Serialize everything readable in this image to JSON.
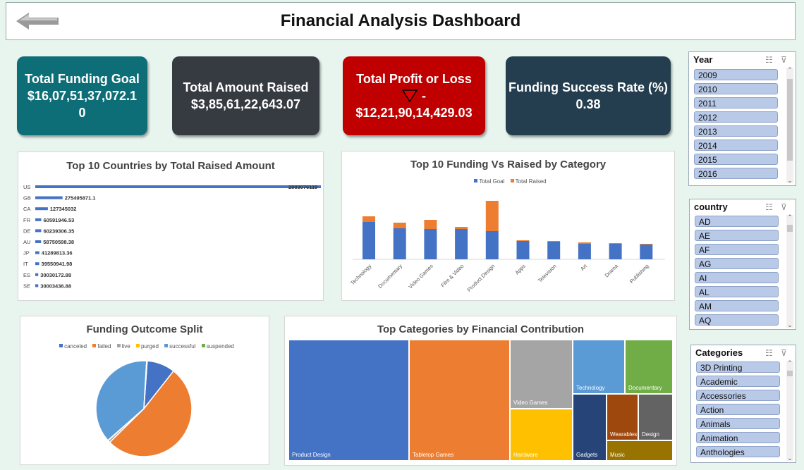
{
  "header": {
    "title": "Financial Analysis Dashboard"
  },
  "kpis": {
    "funding_goal": {
      "label": "Total Funding Goal",
      "value_line1": "$16,07,51,37,072.1",
      "value_line2": "0",
      "color": "#0e6e77"
    },
    "amount_raised": {
      "label": "Total Amount Raised",
      "value": "$3,85,61,22,643.07",
      "color": "#363a41"
    },
    "profit_loss": {
      "label": "Total Profit or Loss",
      "sign": "-",
      "value": "$12,21,90,14,429.03",
      "color": "#c00000"
    },
    "success_rate": {
      "label": "Funding Success Rate (%)",
      "value": "0.38",
      "color": "#243e4f"
    }
  },
  "slicers": {
    "year": {
      "header": "Year",
      "items": [
        "2009",
        "2010",
        "2011",
        "2012",
        "2013",
        "2014",
        "2015",
        "2016"
      ]
    },
    "country": {
      "header": "country",
      "items": [
        "AD",
        "AE",
        "AF",
        "AG",
        "AI",
        "AL",
        "AM",
        "AQ"
      ]
    },
    "categories": {
      "header": "Categories",
      "items": [
        "3D Printing",
        "Academic",
        "Accessories",
        "Action",
        "Animals",
        "Animation",
        "Anthologies"
      ]
    }
  },
  "chart_data": [
    {
      "type": "bar",
      "orientation": "horizontal",
      "title": "Top 10 Countries by Total Raised Amount",
      "categories": [
        "US",
        "GB",
        "CA",
        "FR",
        "DE",
        "AU",
        "JP",
        "IT",
        "ES",
        "SE"
      ],
      "values": [
        2883076119,
        275495871.1,
        127345032,
        60591946.53,
        60239306.35,
        58750598.38,
        41289813.36,
        39550941.98,
        30030172.88,
        30003436.88
      ],
      "labels": [
        "2883076119",
        "275495871.1",
        "127345032",
        "60591946.53",
        "60239306.35",
        "58750598.38",
        "41289813.36",
        "39550941.98",
        "30030172.88",
        "30003436.88"
      ],
      "color": "#4472c4"
    },
    {
      "type": "bar",
      "stacked": true,
      "title": "Top 10 Funding Vs Raised by Category",
      "categories": [
        "Technology",
        "Documentary",
        "Video Games",
        "Film & Video",
        "Product Design",
        "Apps",
        "Television",
        "Art",
        "Drama",
        "Publishing"
      ],
      "series": [
        {
          "name": "Total Goal",
          "color": "#4472c4",
          "values": [
            53,
            44,
            43,
            43,
            40,
            26,
            25,
            22,
            22,
            21
          ]
        },
        {
          "name": "Total Raised",
          "color": "#ed7d31",
          "values": [
            8,
            8,
            13,
            3,
            43,
            1,
            1,
            2,
            1,
            1
          ]
        }
      ],
      "legend": "top"
    },
    {
      "type": "pie",
      "title": "Funding Outcome Split",
      "labels": [
        "canceled",
        "failed",
        "live",
        "purged",
        "successful",
        "suspended"
      ],
      "values": [
        9.5,
        52,
        0.8,
        0.1,
        37.4,
        0.2
      ],
      "colors": [
        "#4472c4",
        "#ed7d31",
        "#a5a5a5",
        "#ffc000",
        "#5b9bd5",
        "#70ad47"
      ],
      "legend": "top"
    },
    {
      "type": "treemap",
      "title": "Top Categories by Financial Contribution",
      "labels": [
        "Product Design",
        "Tabletop Games",
        "Video Games",
        "Hardware",
        "Technology",
        "Documentary",
        "Gadgets",
        "Wearables",
        "Design",
        "Music"
      ],
      "colors": [
        "#4472c4",
        "#ed7d31",
        "#a5a5a5",
        "#ffc000",
        "#5b9bd5",
        "#70ad47",
        "#264478",
        "#9e480e",
        "#636363",
        "#997300"
      ],
      "values": [
        100,
        84,
        34,
        42,
        20,
        20,
        14,
        9,
        9,
        5
      ]
    }
  ]
}
